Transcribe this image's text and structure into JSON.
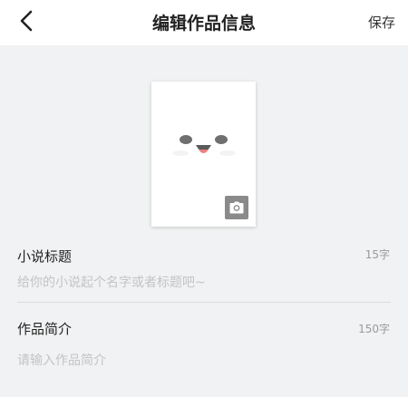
{
  "header": {
    "title": "编辑作品信息",
    "save_label": "保存",
    "back_icon": "chevron-left-icon"
  },
  "cover": {
    "face_icon": "smiley-face-icon",
    "camera_icon": "camera-icon"
  },
  "fields": [
    {
      "label": "小说标题",
      "count": "15字",
      "placeholder": "给你的小说起个名字或者标题吧~"
    },
    {
      "label": "作品简介",
      "count": "150字",
      "placeholder": "请输入作品简介"
    }
  ],
  "colors": {
    "background": "#f0f2f3",
    "header_bg": "#ffffff",
    "placeholder": "#c4c4c4",
    "counter": "#9a9a9a",
    "camera_button": "#8a8a8a",
    "tongue": "#f08080"
  }
}
